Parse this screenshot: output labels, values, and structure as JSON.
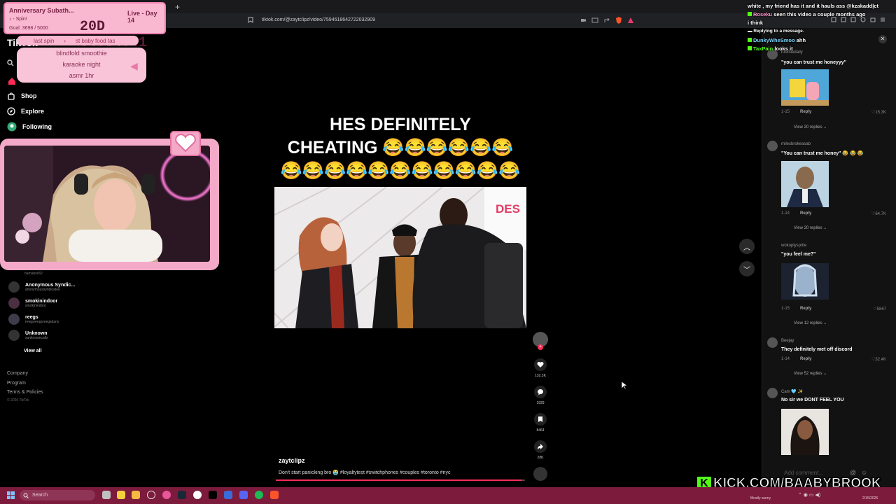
{
  "browser": {
    "url": "tiktok.com/@zaytclipz/video/7594618642722032909",
    "newtab_symbol": "+"
  },
  "tiktok": {
    "logo": "TikTok",
    "nav": [
      {
        "label": "Shop",
        "icon": "shop-icon"
      },
      {
        "label": "Explore",
        "icon": "compass-icon"
      },
      {
        "label": "Following",
        "icon": "following-icon"
      }
    ],
    "accounts": [
      {
        "name": "Anonymous Syndic...",
        "handle": "anonymoussyndicatee"
      },
      {
        "name": "smokinindoor",
        "handle": "smokinindoor"
      },
      {
        "name": "reegs",
        "handle": "reegsreegsreegsdany"
      },
      {
        "name": "Unknown",
        "handle": "xunknowncallx"
      }
    ],
    "partial_account": "bamaboii82",
    "view_all": "View all",
    "footer": [
      "Company",
      "Program",
      "Terms & Policies",
      "© 2026 TikTok"
    ]
  },
  "overlay": {
    "title": "Anniversary Subath...",
    "status": "Live - Day 14",
    "spin": "♪ - Spin!",
    "goal": "Goal: 3698 / 5000",
    "timer": "20D 04:54:41",
    "last_spin_label": "last spin",
    "last_spin_value": "st baby food tas",
    "spin_items": [
      "blindfold smoothie",
      "karaoke night",
      "asmr 1hr"
    ]
  },
  "video": {
    "caption_line1": "HES DEFINITELY",
    "caption_line2": "CHEATING 😂😂😂😂😂😂",
    "caption_line3": "😂😂😂😂😂😂😂😂😂😂😂",
    "sign_text": "DES",
    "creator": "zaytclipz",
    "description": "Don't start panicking bro 😭 #loyaltytest #switchphones #couples #toronto #nyc",
    "progress": 0.99,
    "actions": {
      "likes": "132.3K",
      "comments": "1929",
      "saves": "8464",
      "shares": "28K"
    }
  },
  "comments": [
    {
      "user": "roomiedaily",
      "text": "\"you can trust me honeyyy\"",
      "date": "1-15",
      "likes": "15.3K",
      "replies": "View 20 replies"
    },
    {
      "user": "milesbrokeasab",
      "text": "\"You can trust me honey\" 😂 😂 😂",
      "date": "1-14",
      "likes": "64.7K",
      "replies": "View 20 replies"
    },
    {
      "user": "wokuplysprite",
      "text": "\"you feel me?\"",
      "date": "1-15",
      "likes": "5867",
      "replies": "View 12 replies"
    },
    {
      "user": "Beejay",
      "text": "They definitely met off discord",
      "date": "1-14",
      "likes": "32.4K",
      "replies": "View 52 replies"
    },
    {
      "user": "Cam 🩵 ✨",
      "text": "No sir we DONT FEEL YOU"
    }
  ],
  "comment_reply_label": "Reply",
  "add_comment": "Add comment...",
  "chat": [
    {
      "user": "",
      "text": "white , my friend has it and it hauls ass @kzakadd|ct"
    },
    {
      "user": "Roseku",
      "text": "seen this video a couple months ago"
    },
    {
      "user": "",
      "text": "i think"
    },
    {
      "user": "",
      "text": "Replying to a message."
    },
    {
      "user": "DunkyWheSmoo",
      "text": "ahh"
    },
    {
      "user": "TaxPain",
      "text": "looks it"
    }
  ],
  "kick_banner": "KICK.COM/BAABYBROOK",
  "taskbar": {
    "search": "Search",
    "weather": "Mostly sunny",
    "date": "2/15/2026"
  },
  "colors": {
    "accent": "#fe2c55",
    "kick": "#53fc18",
    "overlay_pink": "#f9b8d0",
    "taskbar": "#7d1b3c"
  }
}
